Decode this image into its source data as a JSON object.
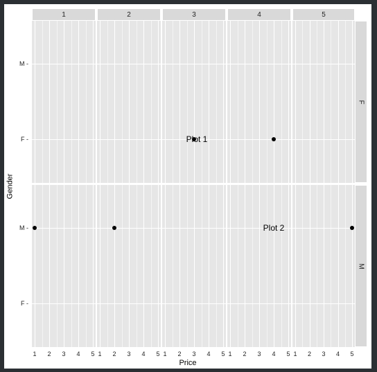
{
  "chart_data": {
    "type": "scatter",
    "title": "",
    "xlabel": "Price",
    "ylabel": "Gender",
    "facets": {
      "columns": [
        "1",
        "2",
        "3",
        "4",
        "5"
      ],
      "rows": [
        "F",
        "M"
      ],
      "x_range": [
        1,
        5
      ],
      "x_ticks": [
        1,
        2,
        3,
        4,
        5
      ],
      "y_categories": [
        "M",
        "F"
      ]
    },
    "points": [
      {
        "row": "F",
        "col": "3",
        "x": 3,
        "y": "F"
      },
      {
        "row": "F",
        "col": "4",
        "x": 4,
        "y": "F"
      },
      {
        "row": "M",
        "col": "1",
        "x": 1,
        "y": "M"
      },
      {
        "row": "M",
        "col": "2",
        "x": 2,
        "y": "M"
      },
      {
        "row": "M",
        "col": "5",
        "x": 5,
        "y": "M"
      }
    ],
    "annotations": [
      {
        "row": "F",
        "col": "3",
        "x": 3,
        "y": "F",
        "text": "Plot 1"
      },
      {
        "row": "M",
        "col": "4",
        "x": 4,
        "y": "M",
        "text": "Plot 2"
      }
    ]
  }
}
